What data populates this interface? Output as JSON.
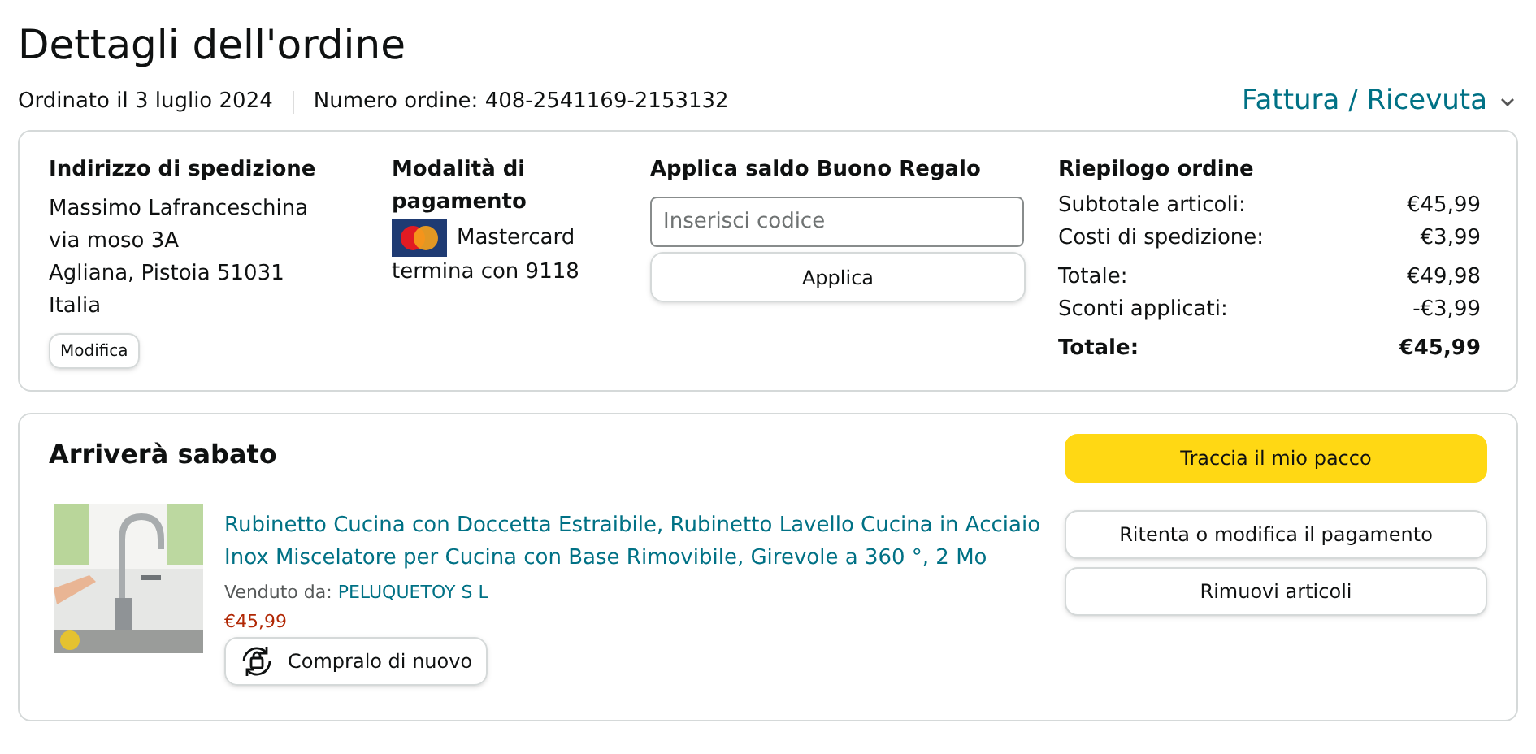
{
  "page_title": "Dettagli dell'ordine",
  "order_date": "Ordinato il 3 luglio 2024",
  "order_number": "Numero ordine: 408-2541169-2153132",
  "invoice_link": "Fattura / Ricevuta",
  "shipping_address": {
    "heading": "Indirizzo di spedizione",
    "lines": [
      "Massimo Lafranceschina",
      "via moso 3A",
      "Agliana, Pistoia 51031",
      "Italia"
    ],
    "edit_button": "Modifica"
  },
  "payment_method": {
    "heading": "Modalità di pagamento",
    "card": "Mastercard",
    "ending": "termina con 9118"
  },
  "gift_card": {
    "heading": "Applica saldo Buono Regalo",
    "placeholder": "Inserisci codice",
    "button": "Applica"
  },
  "summary": {
    "heading": "Riepilogo ordine",
    "groups": [
      [
        {
          "label": "Subtotale articoli:",
          "value": "€45,99",
          "bold": false
        },
        {
          "label": "Costi di spedizione:",
          "value": "€3,99",
          "bold": false
        }
      ],
      [
        {
          "label": "Totale:",
          "value": "€49,98",
          "bold": false
        },
        {
          "label": "Sconti applicati:",
          "value": "-€3,99",
          "bold": false
        }
      ],
      [
        {
          "label": "Totale:",
          "value": "€45,99",
          "bold": true
        }
      ]
    ]
  },
  "shipment": {
    "heading": "Arriverà sabato",
    "item": {
      "kind": "picture",
      "title": "Rubinetto Cucina con Doccetta Estraibile, Rubinetto Lavello Cucina in Acciaio Inox Miscelatore per Cucina con Base Rimovibile, Girevole a 360 °, 2 Mo",
      "sold_by_label": "Venduto da:",
      "seller": "PELUQUETOY S L",
      "price": "€45,99",
      "buy_again": "Compralo di nuovo"
    },
    "actions": [
      {
        "label": "Traccia il mio pacco",
        "kind": "primary"
      },
      {
        "label": "Ritenta o modifica il pagamento",
        "kind": "secondary"
      },
      {
        "label": "Rimuovi articoli",
        "kind": "secondary"
      }
    ]
  }
}
